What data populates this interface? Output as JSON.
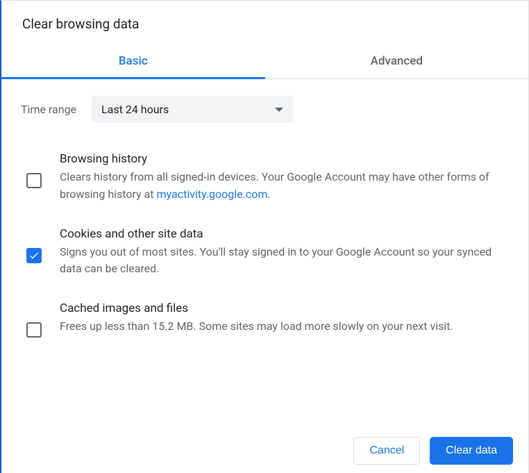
{
  "title": "Clear browsing data",
  "tabs": {
    "basic": "Basic",
    "advanced": "Advanced"
  },
  "time_range": {
    "label": "Time range",
    "selected": "Last 24 hours"
  },
  "options": {
    "browsing_history": {
      "title": "Browsing history",
      "desc_before": "Clears history from all signed-in devices. Your Google Account may have other forms of browsing history at ",
      "link_text": "myactivity.google.com",
      "desc_after": ".",
      "checked": false
    },
    "cookies": {
      "title": "Cookies and other site data",
      "desc": "Signs you out of most sites. You'll stay signed in to your Google Account so your synced data can be cleared.",
      "checked": true
    },
    "cache": {
      "title": "Cached images and files",
      "desc": "Frees up less than 15.2 MB. Some sites may load more slowly on your next visit.",
      "checked": false
    }
  },
  "buttons": {
    "cancel": "Cancel",
    "clear": "Clear data"
  }
}
